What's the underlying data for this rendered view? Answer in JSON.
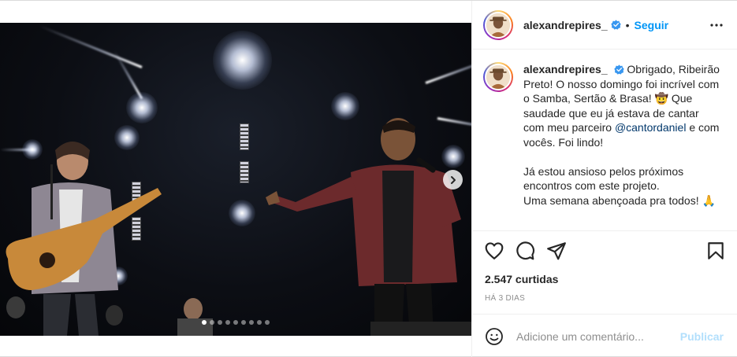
{
  "post": {
    "username": "alexandrepires_",
    "follow_label": "Seguir",
    "separator": "•",
    "caption_parts": {
      "intro": "Obrigado, Ribeirão Preto! O nosso domingo foi incrível com o Samba, Sertão & Brasa! 🤠 Que saudade que eu já estava de cantar com meu parceiro ",
      "mention": "@cantordaniel",
      "after_mention": " e com vocês. Foi lindo!",
      "line2": "Já estou ansioso pelos próximos encontros com este projeto.",
      "line3": "Uma semana abençoada pra todos! 🙏"
    },
    "likes": "2.547 curtidas",
    "time_ago": "HÁ 3 DIAS",
    "comment_placeholder": "Adicione um comentário...",
    "publish_label": "Publicar",
    "carousel": {
      "slides": 9,
      "active_index": 0
    }
  },
  "icons": {
    "verified": "verified-badge-icon",
    "more": "more-options-icon",
    "like": "heart-icon",
    "comment": "comment-icon",
    "share": "share-icon",
    "save": "bookmark-icon",
    "emoji": "emoji-icon",
    "next": "chevron-right-icon"
  },
  "colors": {
    "accent": "#0095f6",
    "verified": "#3897f0",
    "mention": "#00376b",
    "muted": "#8e8e8e",
    "publish_disabled": "#b2dffc"
  }
}
